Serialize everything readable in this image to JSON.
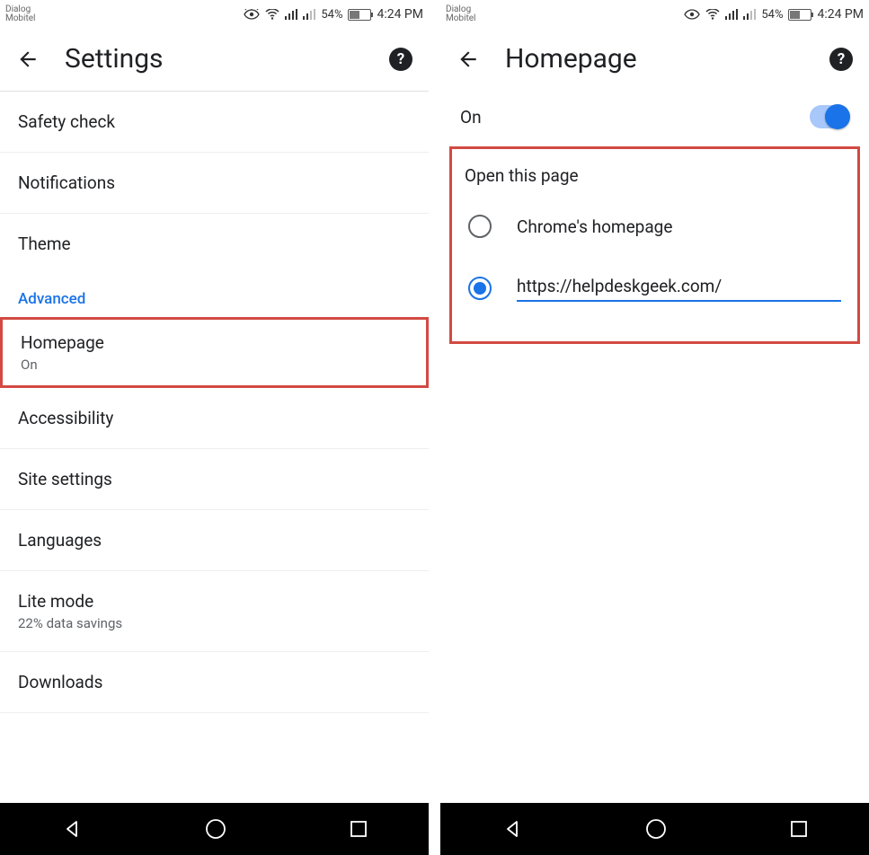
{
  "status": {
    "carrier1": "Dialog",
    "carrier2": "Mobitel",
    "battery_percent": "54%",
    "time": "4:24 PM"
  },
  "left": {
    "title": "Settings",
    "rows": {
      "safety": "Safety check",
      "notifications": "Notifications",
      "theme": "Theme",
      "section_advanced": "Advanced",
      "homepage": "Homepage",
      "homepage_sub": "On",
      "accessibility": "Accessibility",
      "site": "Site settings",
      "languages": "Languages",
      "lite": "Lite mode",
      "lite_sub": "22% data savings",
      "downloads": "Downloads"
    }
  },
  "right": {
    "title": "Homepage",
    "toggle_label": "On",
    "card_title": "Open this page",
    "option_chrome": "Chrome's homepage",
    "option_custom_value": "https://helpdeskgeek.com/"
  },
  "colors": {
    "accent": "#1a73e8",
    "highlight_border": "#d24a43"
  }
}
